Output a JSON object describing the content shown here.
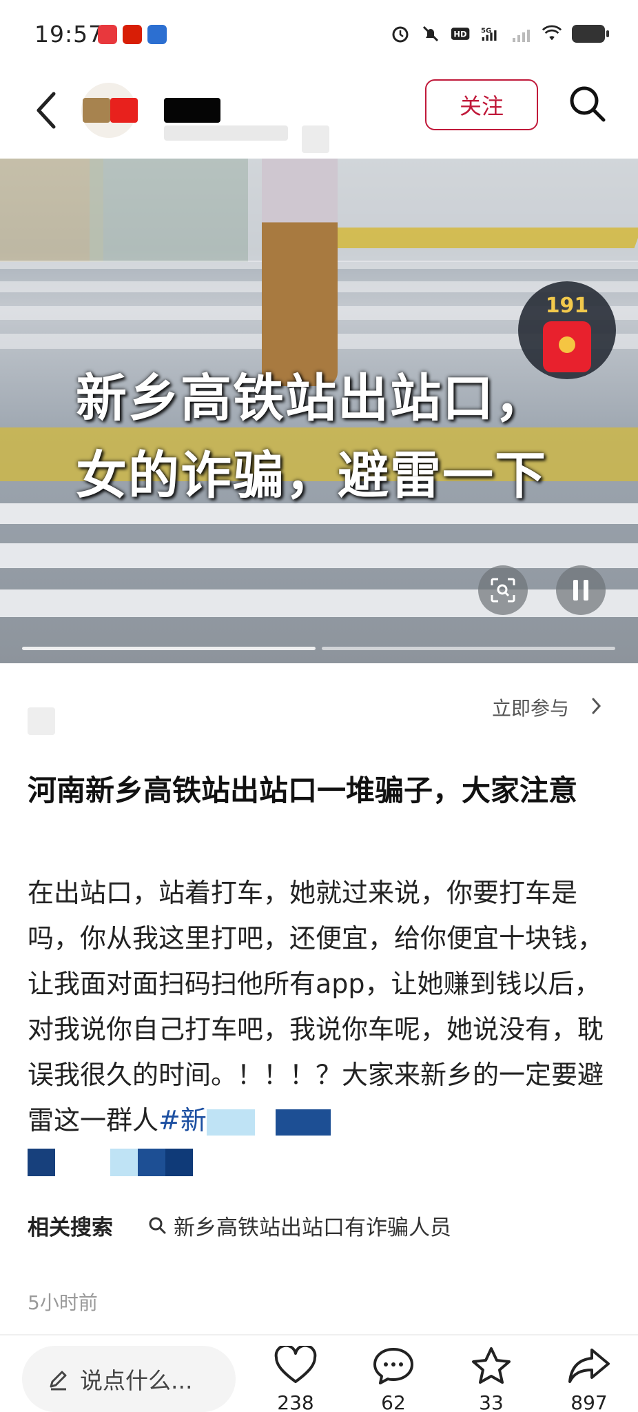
{
  "status_bar": {
    "time": "19:57",
    "app_icons": [
      {
        "label": "头条",
        "color": "#e8383d"
      },
      {
        "label": "天猫",
        "color": "#d81e06"
      },
      {
        "label": "日历",
        "color": "#2c6fd1"
      }
    ],
    "icons": [
      "alarm-icon",
      "mute-icon",
      "hd-icon",
      "signal-5g-icon",
      "signal-icon",
      "wifi-icon",
      "battery-icon"
    ]
  },
  "header": {
    "follow_label": "关注"
  },
  "video": {
    "caption_line1": "新乡高铁站出站口，",
    "caption_line2": "女的诈骗，避雷一下",
    "red_packet_count": "191"
  },
  "activity": {
    "join_label": "立即参与"
  },
  "post": {
    "title": "河南新乡高铁站出站口一堆骗子，大家注意",
    "body": "在出站口，站着打车，她就过来说，你要打车是吗，你从我这里打吧，还便宜，给你便宜十块钱，让我面对面扫码扫他所有app，让她赚到钱以后，对我说你自己打车吧，我说你车呢，她说没有，耽误我很久的时间。！！！？大家来新乡的一定要避雷这一群人",
    "tag_prefix": "#新"
  },
  "related": {
    "label": "相关搜索",
    "query": "新乡高铁站出站口有诈骗人员"
  },
  "meta": {
    "time": "5小时前"
  },
  "bottom_bar": {
    "comment_placeholder": "说点什么...",
    "likes": "238",
    "comments": "62",
    "favorites": "33",
    "shares": "897"
  },
  "colors": {
    "accent": "#c0193a",
    "tag": "#1c4fa1"
  }
}
